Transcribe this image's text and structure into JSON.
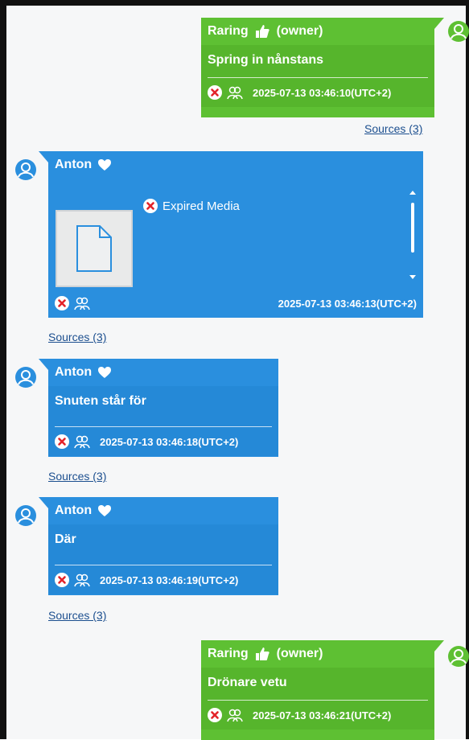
{
  "colors": {
    "outgoing": "#5ec033",
    "incoming": "#2a8fde",
    "link": "#1c4f8f"
  },
  "messages": [
    {
      "sender": "Raring",
      "role": "(owner)",
      "text": "Spring in nånstans",
      "timestamp": "2025-07-13 03:46:10(UTC+2)",
      "sources": "Sources (3)"
    },
    {
      "sender": "Anton",
      "media_status": "Expired Media",
      "timestamp": "2025-07-13 03:46:13(UTC+2)",
      "sources": "Sources (3)"
    },
    {
      "sender": "Anton",
      "text": "Snuten står för",
      "timestamp": "2025-07-13 03:46:18(UTC+2)",
      "sources": "Sources (3)"
    },
    {
      "sender": "Anton",
      "text": "Där",
      "timestamp": "2025-07-13 03:46:19(UTC+2)",
      "sources": "Sources (3)"
    },
    {
      "sender": "Raring",
      "role": "(owner)",
      "text": "Drönare vetu",
      "timestamp": "2025-07-13 03:46:21(UTC+2)"
    }
  ],
  "icons": {
    "avatar": "user-avatar-icon",
    "outgoing_sender_badge": "thumb-icon",
    "incoming_sender_badge": "heart-icon",
    "delete": "close-circle-icon",
    "participants": "people-icon",
    "media": "document-icon"
  }
}
